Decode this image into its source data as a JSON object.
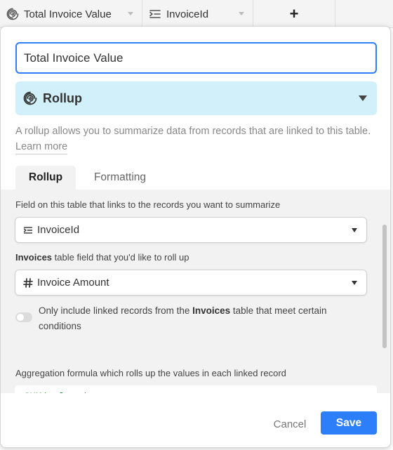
{
  "header": {
    "columns": [
      {
        "label": "Total Invoice Value",
        "icon": "rollup-icon"
      },
      {
        "label": "InvoiceId",
        "icon": "link-field-icon"
      }
    ],
    "add_column_label": "+"
  },
  "dialog": {
    "field_name_value": "Total Invoice Value",
    "field_type": {
      "label": "Rollup",
      "icon": "rollup-icon"
    },
    "description": "A rollup allows you to summarize data from records that are linked to this table.",
    "learn_more": "Learn more",
    "tabs": [
      {
        "label": "Rollup",
        "active": true
      },
      {
        "label": "Formatting",
        "active": false
      }
    ],
    "link_field_label": "Field on this table that links to the records you want to summarize",
    "link_field_value": "InvoiceId",
    "rollup_field_label_table": "Invoices",
    "rollup_field_label_rest": " table field that you'd like to roll up",
    "rollup_field_value": "Invoice Amount",
    "condition_toggle": {
      "on": false,
      "text_before": "Only include linked records from the ",
      "text_table": "Invoices",
      "text_after": " table that meet certain conditions"
    },
    "aggregation_label": "Aggregation formula which rolls up the values in each linked record",
    "aggregation_formula": "SUM(values)",
    "cancel_label": "Cancel",
    "save_label": "Save"
  },
  "colors": {
    "accent": "#2d7ff9",
    "type_background": "#d1f0fa",
    "formula_text": "#2b8a3e"
  }
}
